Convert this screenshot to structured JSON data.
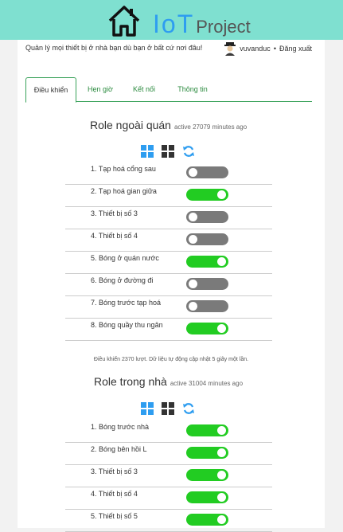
{
  "header": {
    "logo_big": "IoT",
    "logo_small": "Project"
  },
  "topline": {
    "tagline": "Quản lý mọi thiết bị ở nhà bạn dù bạn ở bất cứ nơi đâu!",
    "username": "vuvanduc",
    "separator": "•",
    "logout_label": "Đăng xuất"
  },
  "tabs": [
    {
      "label": "Điều khiển",
      "active": true
    },
    {
      "label": "Hẹn giờ",
      "active": false
    },
    {
      "label": "Kết nối",
      "active": false
    },
    {
      "label": "Thông tin",
      "active": false
    }
  ],
  "sections": [
    {
      "title": "Role ngoài quán",
      "meta": "active 27079 minutes ago",
      "devices": [
        {
          "label": "1. Tạp hoá cổng sau",
          "on": false
        },
        {
          "label": "2. Tạp hoá gian giữa",
          "on": true
        },
        {
          "label": "3. Thiết bị số 3",
          "on": false
        },
        {
          "label": "4. Thiết bị số 4",
          "on": false
        },
        {
          "label": "5. Bóng ở quán nước",
          "on": true
        },
        {
          "label": "6. Bóng ở đường đi",
          "on": false
        },
        {
          "label": "7. Bóng trước tạp hoá",
          "on": false
        },
        {
          "label": "8. Bóng quầy thu ngân",
          "on": true
        }
      ]
    },
    {
      "title": "Role trong nhà",
      "meta": "active 31004 minutes ago",
      "devices": [
        {
          "label": "1. Bóng trước nhà",
          "on": true
        },
        {
          "label": "2. Bóng bên hồi L",
          "on": true
        },
        {
          "label": "3. Thiết bị số 3",
          "on": true
        },
        {
          "label": "4. Thiết bị số 4",
          "on": true
        },
        {
          "label": "5. Thiết bị số 5",
          "on": true
        }
      ]
    }
  ],
  "footnote": "Điều khiển 2370 lượt. Dữ liệu tự động cập nhật 5 giây một lần.",
  "colors": {
    "header_bg": "#7fe0d0",
    "toggle_on": "#22cc22",
    "toggle_off": "#7a7a7a",
    "tab_accent": "#3aa25a",
    "icon_blue": "#2e9df0"
  },
  "icons": [
    "house-icon",
    "avatar-icon",
    "grid-blue-icon",
    "grid-dark-icon",
    "refresh-icon"
  ]
}
